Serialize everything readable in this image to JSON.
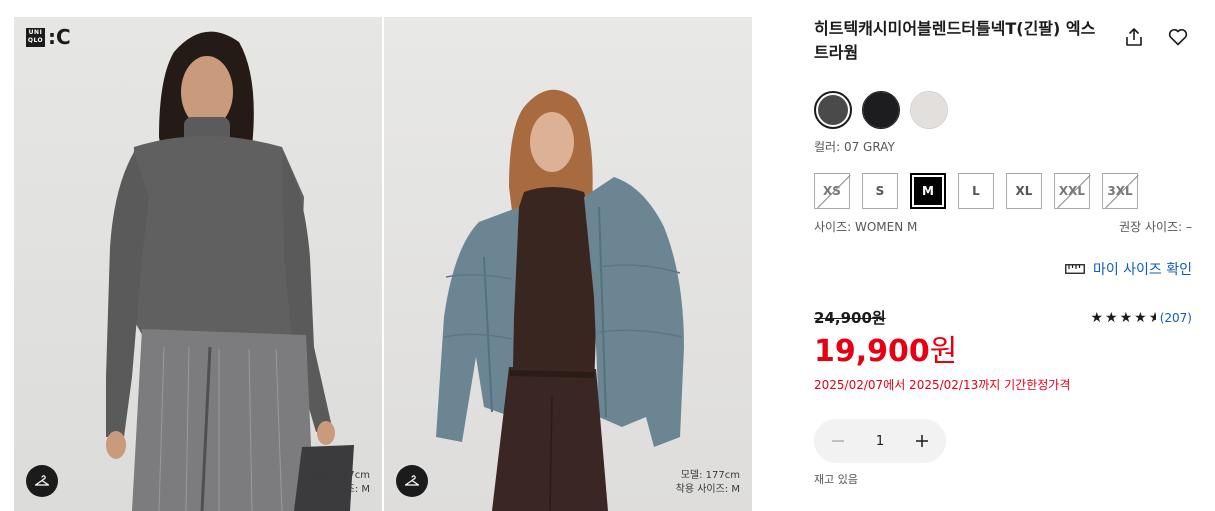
{
  "brand": {
    "logo_text_top": "UNI",
    "logo_text_bottom": "QLO",
    "logo_suffix": ":C"
  },
  "gallery": {
    "photos": [
      {
        "model_height": "모델: 177cm",
        "model_size": "착용 사이즈: M"
      },
      {
        "model_height": "모델: 177cm",
        "model_size": "착용 사이즈: M"
      }
    ]
  },
  "product": {
    "title": "히트텍캐시미어블렌드터틀넥T(긴팔) 엑스트라웜",
    "colors": [
      {
        "name": "gray",
        "hex": "#4a4a4a",
        "selected": true
      },
      {
        "name": "black",
        "hex": "#1d1d1f",
        "selected": false
      },
      {
        "name": "off-white",
        "hex": "#e3dfdc",
        "selected": false
      }
    ],
    "color_label": "컬러: 07 GRAY",
    "sizes": [
      {
        "label": "XS",
        "state": "disabled"
      },
      {
        "label": "S",
        "state": "available"
      },
      {
        "label": "M",
        "state": "selected"
      },
      {
        "label": "L",
        "state": "available"
      },
      {
        "label": "XL",
        "state": "available"
      },
      {
        "label": "XXL",
        "state": "disabled"
      },
      {
        "label": "3XL",
        "state": "disabled"
      }
    ],
    "size_label": "사이즈: WOMEN M",
    "recommended_size": "권장 사이즈: –",
    "my_size_link": "마이 사이즈 확인",
    "original_price": "24,900원",
    "rating": {
      "stars": 4.5,
      "count": "(207)"
    },
    "sale_price": "19,900",
    "sale_currency": "원",
    "sale_period": "2025/02/07에서 2025/02/13까지 기간한정가격",
    "quantity": "1",
    "stock_status": "재고 있음"
  },
  "colors": {
    "accent_red": "#e60012",
    "link_blue": "#0f5db5"
  }
}
